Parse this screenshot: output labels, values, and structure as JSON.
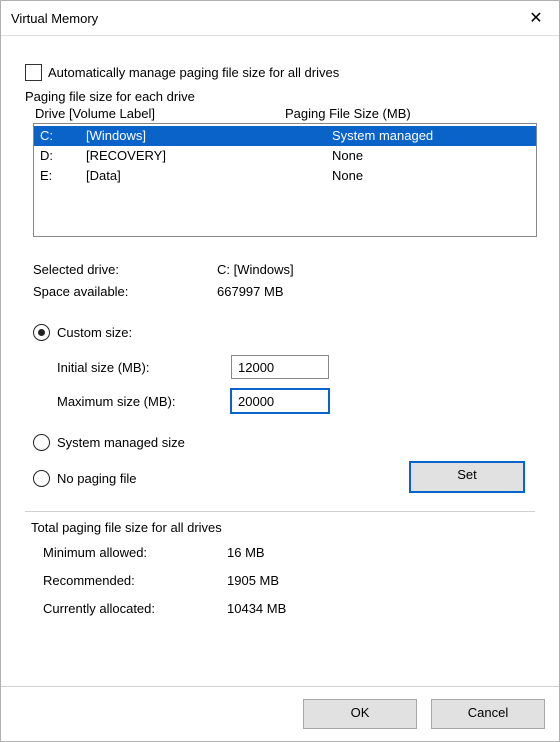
{
  "window": {
    "title": "Virtual Memory",
    "close_glyph": "✕"
  },
  "auto_manage": {
    "label": "Automatically manage paging file size for all drives",
    "checked": false
  },
  "drive_section": {
    "heading": "Paging file size for each drive",
    "col_drive": "Drive  [Volume Label]",
    "col_size": "Paging File Size (MB)",
    "rows": [
      {
        "letter": "C:",
        "volume": "[Windows]",
        "size": "System managed",
        "selected": true
      },
      {
        "letter": "D:",
        "volume": "[RECOVERY]",
        "size": "None",
        "selected": false
      },
      {
        "letter": "E:",
        "volume": "[Data]",
        "size": "None",
        "selected": false
      }
    ]
  },
  "selected_drive": {
    "label": "Selected drive:",
    "value": "C:  [Windows]",
    "space_label": "Space available:",
    "space_value": "667997 MB"
  },
  "size_option": {
    "custom_label": "Custom size:",
    "system_label": "System managed size",
    "none_label": "No paging file",
    "selected": "custom",
    "initial_label": "Initial size (MB):",
    "initial_value": "12000",
    "maximum_label": "Maximum size (MB):",
    "maximum_value": "20000"
  },
  "set_button": "Set",
  "totals": {
    "heading": "Total paging file size for all drives",
    "min_label": "Minimum allowed:",
    "min_value": "16 MB",
    "rec_label": "Recommended:",
    "rec_value": "1905 MB",
    "cur_label": "Currently allocated:",
    "cur_value": "10434 MB"
  },
  "buttons": {
    "ok": "OK",
    "cancel": "Cancel"
  }
}
